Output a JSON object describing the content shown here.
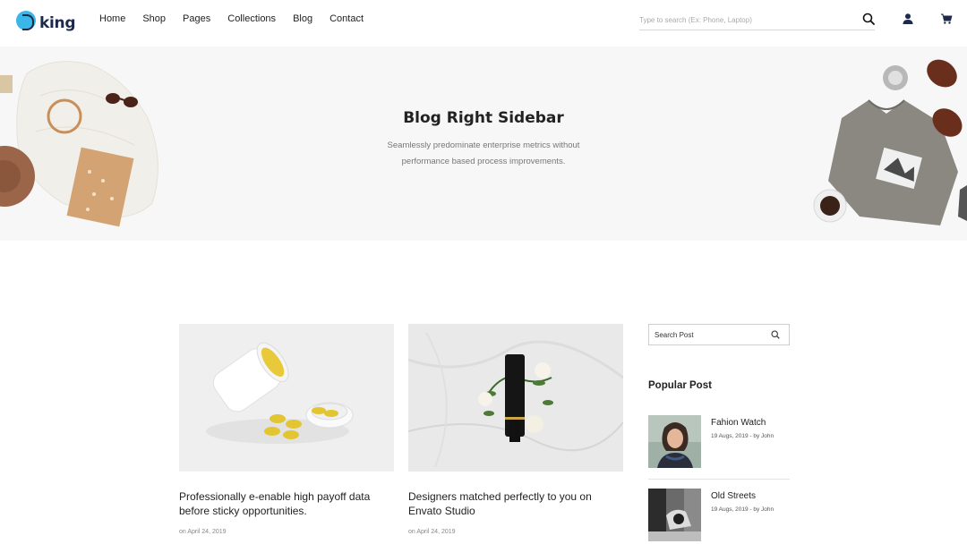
{
  "logo": {
    "text": "king"
  },
  "nav": {
    "items": [
      "Home",
      "Shop",
      "Pages",
      "Collections",
      "Blog",
      "Contact"
    ]
  },
  "search": {
    "placeholder": "Type to search (Ex: Phone, Laptop)"
  },
  "hero": {
    "title": "Blog Right Sidebar",
    "subtitle_line1": "Seamlessly predominate enterprise metrics without",
    "subtitle_line2": "performance based process improvements."
  },
  "posts": [
    {
      "title": "Professionally e-enable high payoff data before sticky opportunities.",
      "meta": "on April 24, 2019"
    },
    {
      "title": "Designers matched perfectly to you on Envato Studio",
      "meta": "on April 24, 2019"
    }
  ],
  "sidebar": {
    "search_placeholder": "Search Post",
    "popular_heading": "Popular Post",
    "popular": [
      {
        "title": "Fahion Watch",
        "meta": "19 Augs, 2019 - by John"
      },
      {
        "title": "Old Streets",
        "meta": "19 Augs, 2019 - by John"
      }
    ]
  },
  "colors": {
    "brand": "#3ab7e8",
    "text": "#222222",
    "hero_bg": "#f7f7f7"
  }
}
